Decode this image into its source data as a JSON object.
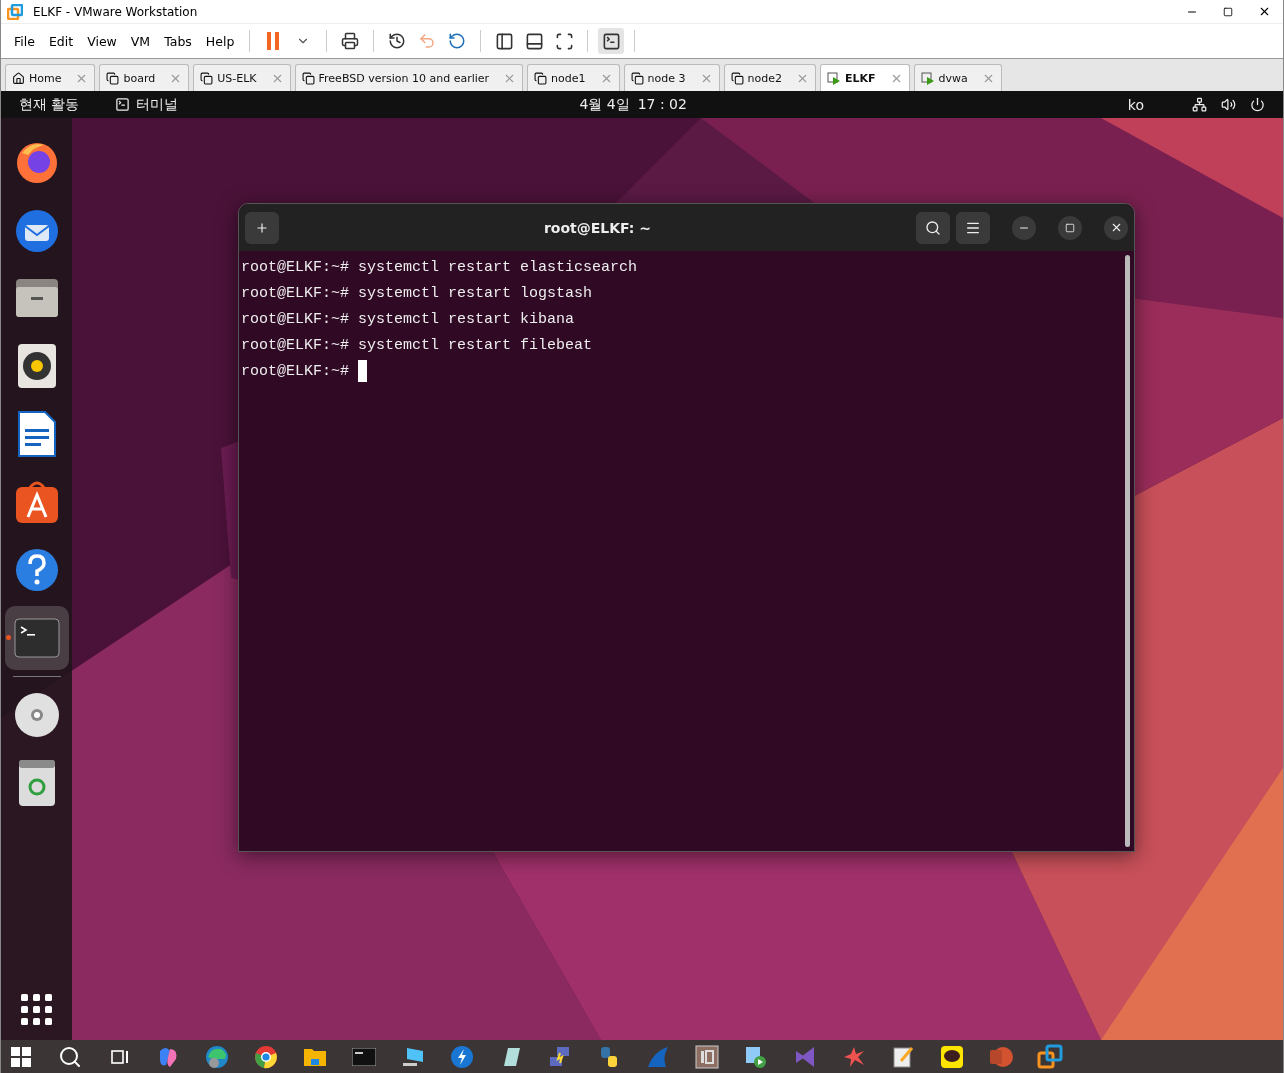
{
  "window": {
    "title": "ELKF - VMware Workstation"
  },
  "menu": [
    "File",
    "Edit",
    "View",
    "VM",
    "Tabs",
    "Help"
  ],
  "tabs": [
    {
      "label": "Home",
      "kind": "home",
      "selected": false
    },
    {
      "label": "board",
      "kind": "vm",
      "selected": false
    },
    {
      "label": "US-ELK",
      "kind": "vm",
      "selected": false
    },
    {
      "label": "FreeBSD version 10 and earlier",
      "kind": "vm",
      "selected": false
    },
    {
      "label": "node1",
      "kind": "vm",
      "selected": false
    },
    {
      "label": "node 3",
      "kind": "vm",
      "selected": false
    },
    {
      "label": "node2",
      "kind": "vm",
      "selected": false
    },
    {
      "label": "ELKF",
      "kind": "running",
      "selected": true
    },
    {
      "label": "dvwa",
      "kind": "running",
      "selected": false
    }
  ],
  "top_bar": {
    "activities": "현재 활동",
    "app": "터미널",
    "date": "4월 4일",
    "time": "17 : 02",
    "input_method": "ko"
  },
  "dock": [
    {
      "kind": "firefox",
      "selected": false,
      "running": false
    },
    {
      "kind": "thunderbird",
      "selected": false,
      "running": false
    },
    {
      "kind": "files",
      "selected": false,
      "running": false
    },
    {
      "kind": "rhythmbox",
      "selected": false,
      "running": false
    },
    {
      "kind": "writer",
      "selected": false,
      "running": false
    },
    {
      "kind": "appcenter",
      "selected": false,
      "running": false
    },
    {
      "kind": "help",
      "selected": false,
      "running": false
    },
    {
      "kind": "terminal",
      "selected": true,
      "running": true
    },
    {
      "kind": "disc",
      "selected": false,
      "running": false
    },
    {
      "kind": "trash",
      "selected": false,
      "running": false
    }
  ],
  "terminal": {
    "title": "root@ELKF: ~",
    "lines": [
      "root@ELKF:~# systemctl restart elasticsearch",
      "root@ELKF:~# systemctl restart logstash",
      "root@ELKF:~# systemctl restart kibana",
      "root@ELKF:~# systemctl restart filebeat"
    ],
    "prompt": "root@ELKF:~# "
  }
}
